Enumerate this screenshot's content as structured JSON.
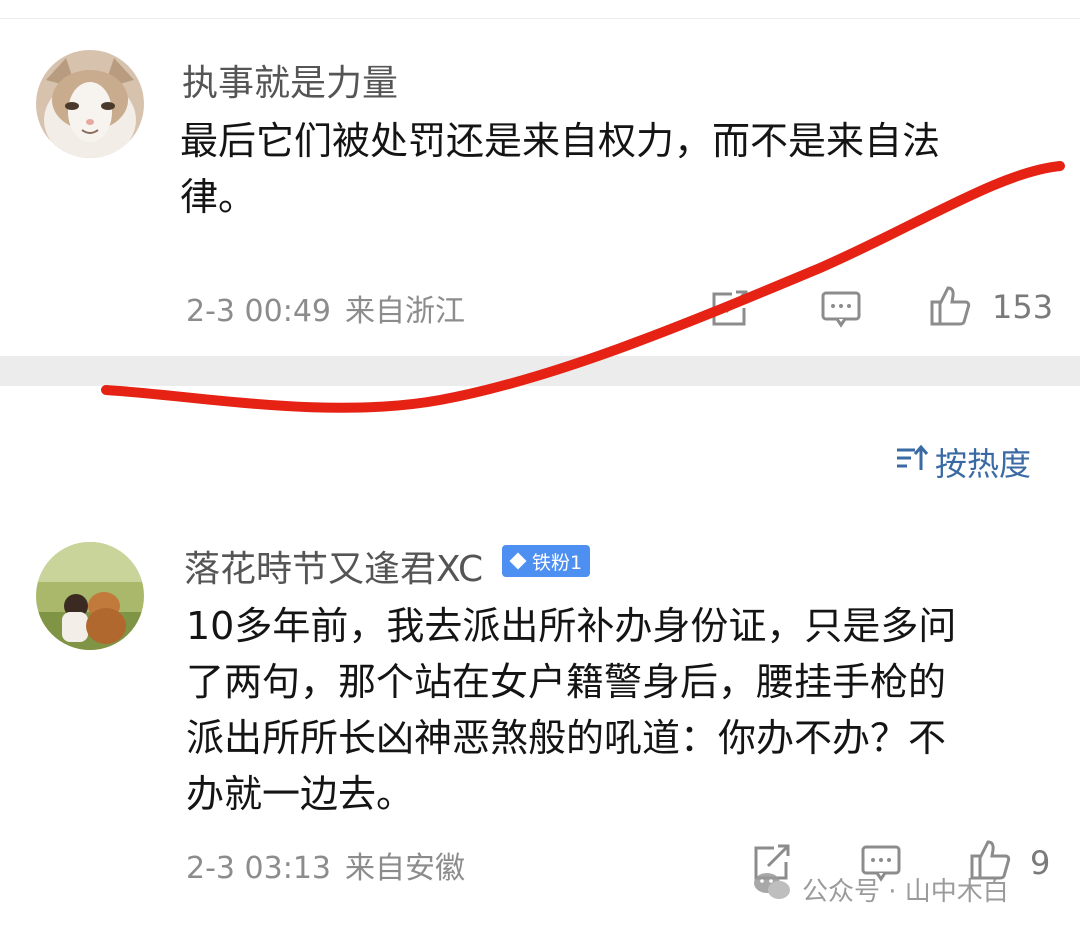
{
  "comments": [
    {
      "username": "执事就是力量",
      "text_lines": [
        "最后它们被处罚还是来自权力，而不是来自法",
        "律。"
      ],
      "time": "2-3 00:49",
      "location": "来自浙江",
      "likes": "153"
    },
    {
      "username": "落花時节又逢君XC",
      "badge": "铁粉1",
      "text_lines": [
        "10多年前，我去派出所补办身份证，只是多问",
        "了两句，那个站在女户籍警身后，腰挂手枪的",
        "派出所所长凶神恶煞般的吼道：你办不办？不",
        "办就一边去。"
      ],
      "time": "2-3 03:13",
      "location": "来自安徽",
      "likes": "9"
    }
  ],
  "sort": {
    "label": "按热度",
    "icon": "sort-icon"
  },
  "watermark": {
    "label": "公众号 · 山中木白",
    "icon": "wechat-icon"
  },
  "colors": {
    "stroke": "#e52214",
    "link": "#3a6aa4",
    "badge": "#4e8ff2"
  }
}
